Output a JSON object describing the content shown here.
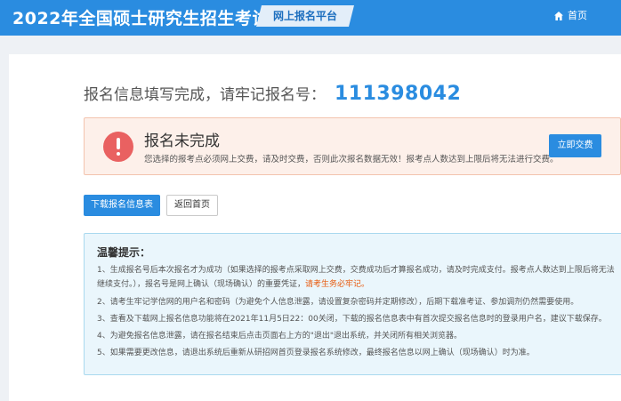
{
  "header": {
    "site_title": "2022年全国硕士研究生招生考试",
    "platform_label": "网上报名平台",
    "home_label": "首页"
  },
  "main": {
    "reg_prefix": "报名信息填写完成，请牢记报名号：",
    "reg_number": "111398042",
    "alert": {
      "title": "报名未完成",
      "desc": "您选择的报考点必须网上交费，请及时交费，否则此次报名数据无效！报考点人数达到上限后将无法进行交费。",
      "pay_label": "立即交费"
    },
    "download_label": "下载报名信息表",
    "back_label": "返回首页",
    "tips": {
      "title": "温馨提示：",
      "item1_a": "1、生成报名号后本次报名才为成功（如果选择的报考点采取网上交费，交费成功后才算报名成功，请及时完成支付。报考点人数达到上限后将无法继续支付。），报名号是网上确认（现场确认）的重要凭证，",
      "item1_b": "请考生务必牢记。",
      "item2": "2、请考生牢记学信网的用户名和密码（为避免个人信息泄露，请设置复杂密码并定期修改），后期下载准考证、参加调剂仍然需要使用。",
      "item3": "3、查看及下载网上报名信息功能将在2021年11月5日22：00关闭，下载的报名信息表中有首次提交报名信息时的登录用户名，建议下载保存。",
      "item4": "4、为避免报名信息泄露，请在报名结束后点击页面右上方的\"退出\"退出系统，并关闭所有相关浏览器。",
      "item5": "5、如果需要更改信息，请退出系统后重新从研招网首页登录报名系统修改，最终报名信息以网上确认（现场确认）时为准。"
    }
  },
  "colors": {
    "brand_blue": "#2a8ce0",
    "alert_bg": "#fdf0ea",
    "alert_icon": "#e96161",
    "warn_text": "#e8590c",
    "tips_bg": "#eaf6fc"
  },
  "icons": {
    "home": "home-icon",
    "alert": "exclamation-circle-icon"
  }
}
